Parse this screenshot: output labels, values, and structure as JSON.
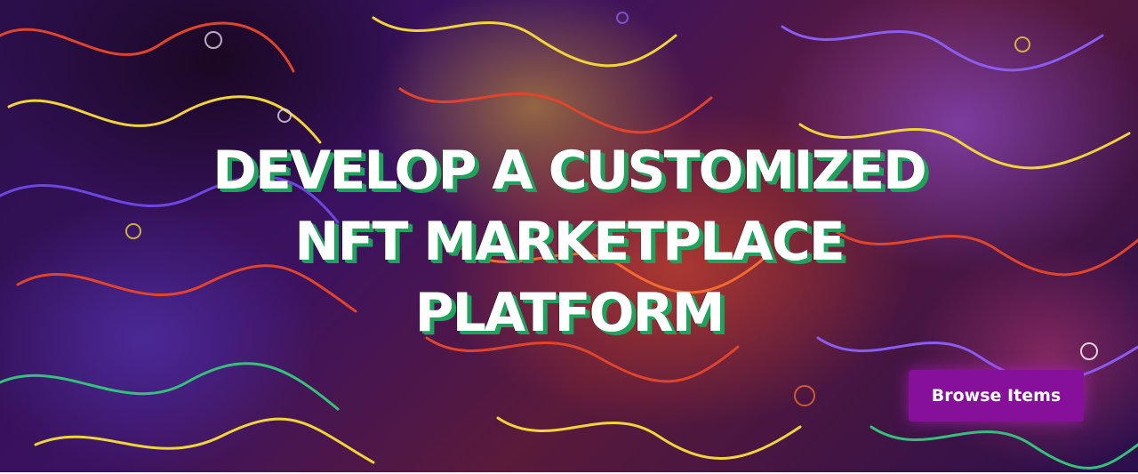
{
  "hero": {
    "title_lines": [
      "DEVELOP A CUSTOMIZED",
      "NFT MARKETPLACE",
      "PLATFORM"
    ],
    "browse_button_label": "Browse Items"
  },
  "colors": {
    "title_text": "#ffffff",
    "title_shadow": "#1fa35c",
    "button_background": "#86109a",
    "button_text": "#ffffff"
  }
}
